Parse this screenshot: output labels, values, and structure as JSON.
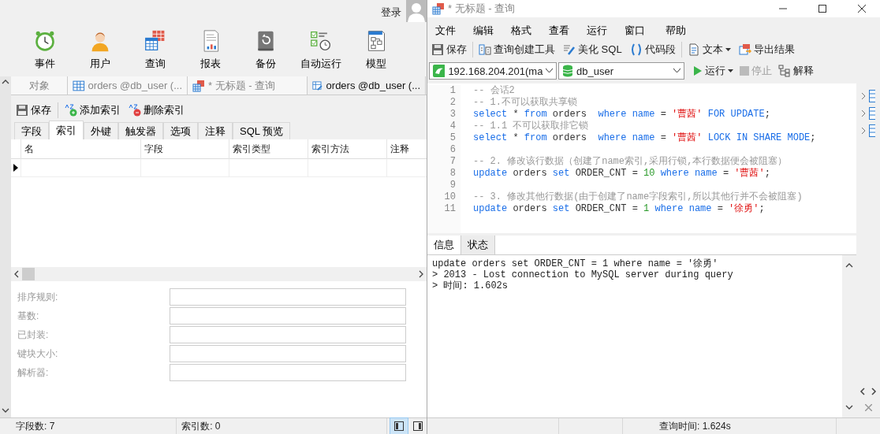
{
  "left": {
    "login": "登录",
    "toolbar": [
      {
        "label": "事件"
      },
      {
        "label": "用户"
      },
      {
        "label": "查询"
      },
      {
        "label": "报表"
      },
      {
        "label": "备份"
      },
      {
        "label": "自动运行"
      },
      {
        "label": "模型"
      }
    ],
    "tabs": [
      {
        "label": "对象",
        "selected": false
      },
      {
        "label": "orders @db_user (...",
        "selected": false
      },
      {
        "label": "* 无标题 - 查询",
        "selected": false
      },
      {
        "label": "orders @db_user (...",
        "selected": true
      }
    ],
    "actions": [
      {
        "label": "保存"
      },
      {
        "label": "添加索引"
      },
      {
        "label": "删除索引"
      }
    ],
    "subtabs": [
      {
        "label": "字段",
        "selected": false
      },
      {
        "label": "索引",
        "selected": true
      },
      {
        "label": "外键",
        "selected": false
      },
      {
        "label": "触发器",
        "selected": false
      },
      {
        "label": "选项",
        "selected": false
      },
      {
        "label": "注释",
        "selected": false
      },
      {
        "label": "SQL 预览",
        "selected": false
      }
    ],
    "table": {
      "columns": [
        "名",
        "字段",
        "索引类型",
        "索引方法",
        "注释"
      ]
    },
    "properties": [
      {
        "label": "排序规则:"
      },
      {
        "label": "基数:"
      },
      {
        "label": "已封装:"
      },
      {
        "label": "键块大小:"
      },
      {
        "label": "解析器:"
      }
    ],
    "status_bar": {
      "fields": "字段数: 7",
      "indexes": "索引数: 0",
      "views": [
        {
          "selected": true
        },
        {
          "selected": false
        }
      ]
    }
  },
  "right": {
    "window": {
      "title": "* 无标题 - 查询"
    },
    "menu": [
      "文件",
      "编辑",
      "格式",
      "查看",
      "运行",
      "窗口",
      "帮助"
    ],
    "toolbar": [
      {
        "label": "保存"
      },
      {
        "label": "查询创建工具"
      },
      {
        "label": "美化 SQL"
      },
      {
        "label": "代码段"
      },
      {
        "label": "文本",
        "dropdown": true
      },
      {
        "label": "导出结果"
      }
    ],
    "connection": "192.168.204.201(ma",
    "database": "db_user",
    "run": {
      "label": "运行"
    },
    "stop": {
      "label": "停止",
      "disabled": true
    },
    "explain": {
      "label": "解释"
    },
    "code_lines": [
      {
        "number": "1",
        "tokens": [
          {
            "kind": "comment",
            "text": "-- 会话2"
          }
        ]
      },
      {
        "number": "2",
        "tokens": [
          {
            "kind": "comment",
            "text": "-- 1.不可以获取共享锁"
          }
        ]
      },
      {
        "number": "3",
        "tokens": [
          {
            "kind": "keyword",
            "text": "select"
          },
          {
            "kind": "plain",
            "text": " * "
          },
          {
            "kind": "keyword",
            "text": "from"
          },
          {
            "kind": "plain",
            "text": " orders  "
          },
          {
            "kind": "keyword",
            "text": "where name"
          },
          {
            "kind": "plain",
            "text": " = "
          },
          {
            "kind": "string",
            "text": "'曹茜'"
          },
          {
            "kind": "keyword",
            "text": " FOR UPDATE"
          },
          {
            "kind": "plain",
            "text": ";"
          }
        ]
      },
      {
        "number": "4",
        "tokens": [
          {
            "kind": "comment",
            "text": "-- 1.1 不可以获取排它锁"
          }
        ]
      },
      {
        "number": "5",
        "tokens": [
          {
            "kind": "keyword",
            "text": "select"
          },
          {
            "kind": "plain",
            "text": " * "
          },
          {
            "kind": "keyword",
            "text": "from"
          },
          {
            "kind": "plain",
            "text": " orders  "
          },
          {
            "kind": "keyword",
            "text": "where name"
          },
          {
            "kind": "plain",
            "text": " = "
          },
          {
            "kind": "string",
            "text": "'曹茜'"
          },
          {
            "kind": "keyword",
            "text": " LOCK IN SHARE MODE"
          },
          {
            "kind": "plain",
            "text": ";"
          }
        ]
      },
      {
        "number": "6"
      },
      {
        "number": "7",
        "tokens": [
          {
            "kind": "comment",
            "text": "-- 2. 修改该行数据（创建了name索引,采用行锁,本行数据便会被阻塞）"
          }
        ]
      },
      {
        "number": "8",
        "tokens": [
          {
            "kind": "keyword",
            "text": "update"
          },
          {
            "kind": "plain",
            "text": " orders "
          },
          {
            "kind": "keyword",
            "text": "set"
          },
          {
            "kind": "plain",
            "text": " ORDER_CNT = "
          },
          {
            "kind": "number",
            "text": "10"
          },
          {
            "kind": "keyword",
            "text": " where name"
          },
          {
            "kind": "plain",
            "text": " = "
          },
          {
            "kind": "string",
            "text": "'曹茜'"
          },
          {
            "kind": "plain",
            "text": ";"
          }
        ]
      },
      {
        "number": "9"
      },
      {
        "number": "10",
        "tokens": [
          {
            "kind": "comment",
            "text": "-- 3. 修改其他行数据(由于创建了name字段索引,所以其他行并不会被阻塞)"
          }
        ]
      },
      {
        "number": "11",
        "tokens": [
          {
            "kind": "keyword",
            "text": "update"
          },
          {
            "kind": "plain",
            "text": " orders "
          },
          {
            "kind": "keyword",
            "text": "set"
          },
          {
            "kind": "plain",
            "text": " ORDER_CNT = "
          },
          {
            "kind": "number",
            "text": "1"
          },
          {
            "kind": "keyword",
            "text": " where name"
          },
          {
            "kind": "plain",
            "text": " = "
          },
          {
            "kind": "string",
            "text": "'徐勇'"
          },
          {
            "kind": "plain",
            "text": ";"
          }
        ]
      }
    ],
    "result_tabs": [
      {
        "label": "信息",
        "selected": true
      },
      {
        "label": "状态",
        "selected": false
      }
    ],
    "messages": [
      "update orders set ORDER_CNT = 1 where name = '徐勇'",
      "> 2013 - Lost connection to MySQL server during query",
      "> 时间: 1.602s"
    ],
    "status_bar": {
      "query_time": "查询时间: 1.624s"
    }
  }
}
